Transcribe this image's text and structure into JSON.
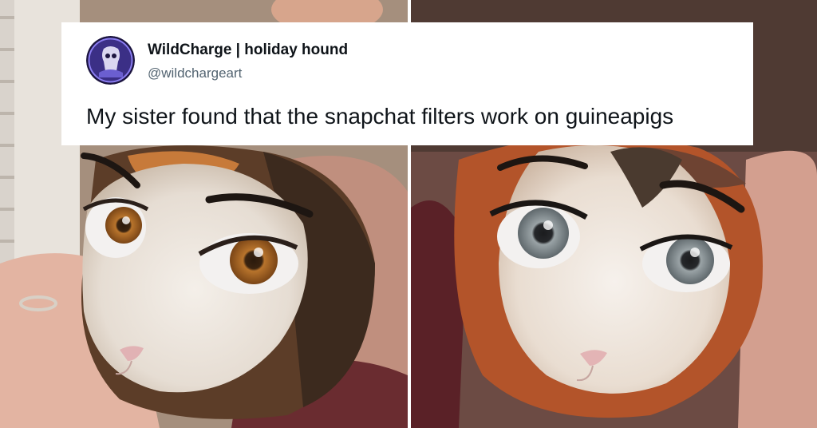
{
  "tweet": {
    "display_name": "WildCharge | holiday hound",
    "handle": "@wildchargeart",
    "text": "My sister found that the snapchat filters work on guineapigs",
    "avatar_icon": "skull-knight-icon"
  },
  "photos": [
    {
      "subject": "calico guinea pig with cartoon eyes filter"
    },
    {
      "subject": "tricolor guinea pig with cartoon eyes filter"
    }
  ],
  "colors": {
    "card_bg": "#ffffff",
    "name_text": "#0f1419",
    "handle_text": "#536471",
    "avatar_bg": "#3b2f86"
  }
}
